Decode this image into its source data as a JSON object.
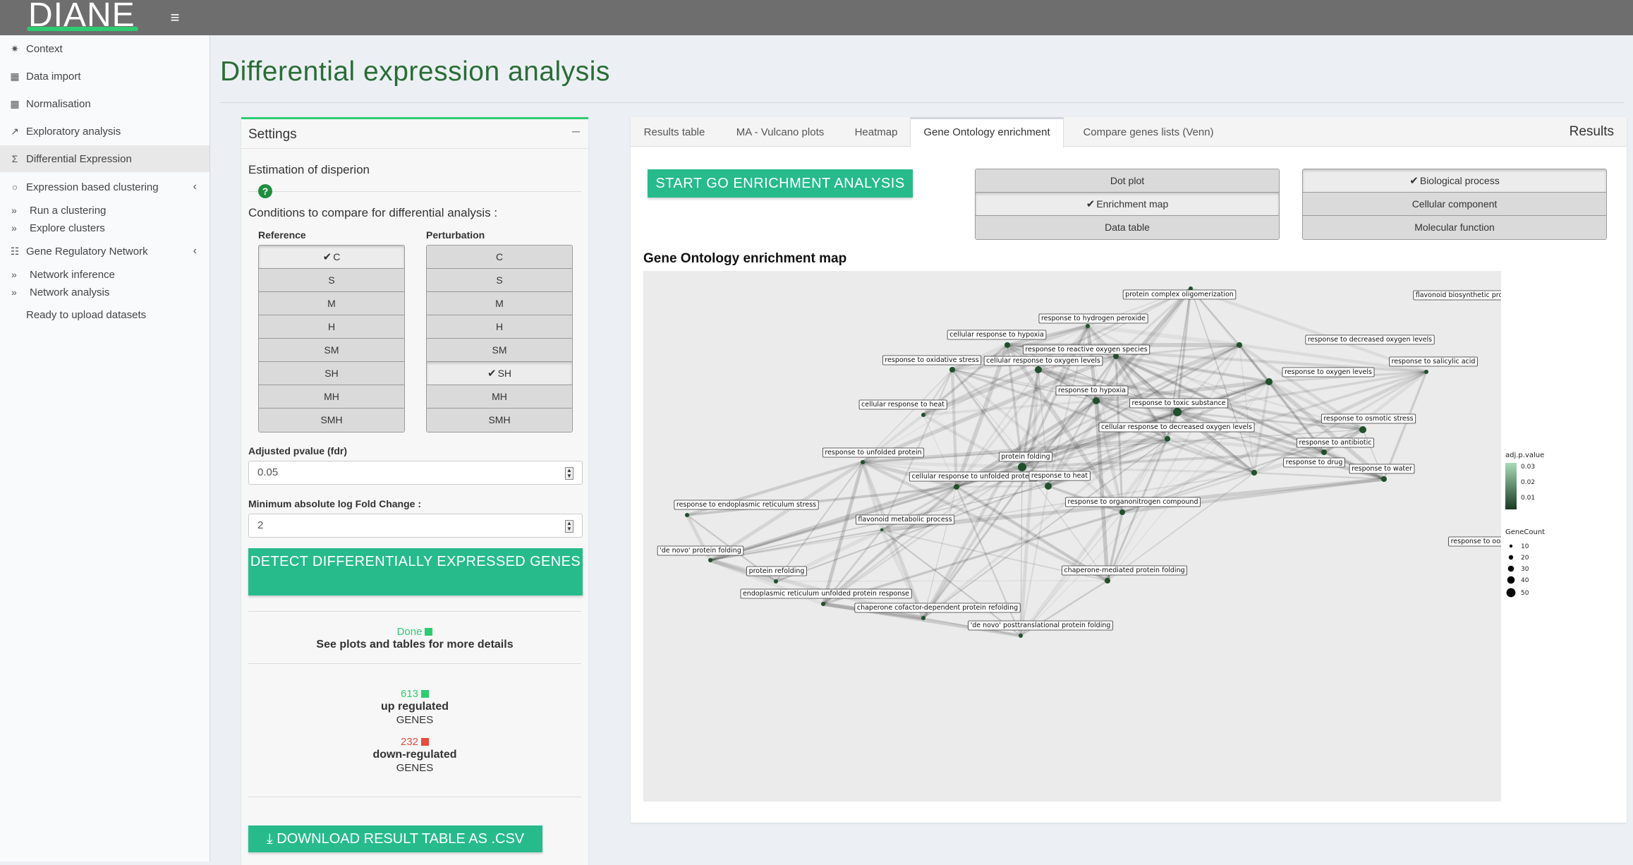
{
  "app": {
    "logo": "DIANE"
  },
  "sidebar": {
    "items": [
      {
        "label": "Context",
        "icon": "seedling-icon"
      },
      {
        "label": "Data import",
        "icon": "table-icon"
      },
      {
        "label": "Normalisation",
        "icon": "table-icon"
      },
      {
        "label": "Exploratory analysis",
        "icon": "line-chart-icon"
      },
      {
        "label": "Differential Expression",
        "icon": "sigma-icon",
        "active": true
      },
      {
        "label": "Expression based clustering",
        "icon": "circle-icon"
      },
      {
        "label": "Run a clustering"
      },
      {
        "label": "Explore clusters"
      },
      {
        "label": "Gene Regulatory Network",
        "icon": "sitemap-icon"
      },
      {
        "label": "Network inference"
      },
      {
        "label": "Network analysis"
      },
      {
        "label": "Ready to upload datasets",
        "icon": "cloud-upload-icon"
      }
    ]
  },
  "page": {
    "title": "Differential expression analysis"
  },
  "settings": {
    "title": "Settings",
    "estimation_label": "Estimation of disperion",
    "conditions_label": "Conditions to compare for differential analysis :",
    "reference_label": "Reference",
    "perturbation_label": "Perturbation",
    "reference_options": [
      "C",
      "S",
      "M",
      "H",
      "SM",
      "SH",
      "MH",
      "SMH"
    ],
    "reference_selected": "C",
    "perturbation_options": [
      "C",
      "S",
      "M",
      "H",
      "SM",
      "SH",
      "MH",
      "SMH"
    ],
    "perturbation_selected": "SH",
    "pvalue_label": "Adjusted pvalue (fdr)",
    "pvalue_value": "0.05",
    "logfc_label": "Minimum absolute log Fold Change :",
    "logfc_value": "2",
    "detect_button": "DETECT DIFFERENTIALLY EXPRESSED GENES",
    "status_done": "Done",
    "status_detail": "See plots and tables for more details",
    "up_count": "613",
    "up_label": "up regulated",
    "up_genes": "GENES",
    "down_count": "232",
    "down_label": "down-regulated",
    "down_genes": "GENES",
    "download_button": "DOWNLOAD RESULT TABLE AS .CSV"
  },
  "results": {
    "title": "Results",
    "tabs": [
      "Results table",
      "MA - Vulcano plots",
      "Heatmap",
      "Gene Ontology enrichment",
      "Compare genes lists (Venn)"
    ],
    "active_tab": "Gene Ontology enrichment",
    "go_button": "START GO ENRICHMENT ANALYSIS",
    "plot_type_options": [
      "Dot plot",
      "Enrichment map",
      "Data table"
    ],
    "plot_type_selected": "Enrichment map",
    "ontology_options": [
      "Biological process",
      "Cellular component",
      "Molecular function"
    ],
    "ontology_selected": "Biological process",
    "plot_title": "Gene Ontology enrichment map",
    "legend": {
      "color_title": "adj.p.value",
      "color_ticks": [
        "0.03",
        "0.02",
        "0.01"
      ],
      "size_title": "GeneCount",
      "size_ticks": [
        "10",
        "20",
        "30",
        "40",
        "50"
      ]
    },
    "network_nodes": [
      "protein complex oligomerization",
      "flavonoid biosynthetic process",
      "response to hydrogen peroxide",
      "cellular response to hypoxia",
      "response to decreased oxygen levels",
      "response to reactive oxygen species",
      "response to oxidative stress",
      "cellular response to oxygen levels",
      "response to salicylic acid",
      "response to oxygen levels",
      "response to hypoxia",
      "response to toxic substance",
      "cellular response to heat",
      "response to osmotic stress",
      "cellular response to decreased oxygen levels",
      "response to antibiotic",
      "response to unfolded protein",
      "protein folding",
      "response to drug",
      "response to water",
      "cellular response to unfolded protein",
      "response to heat",
      "response to endoplasmic reticulum stress",
      "response to organonitrogen compound",
      "flavonoid metabolic process",
      "response to oomycetes",
      "'de novo' protein folding",
      "protein refolding",
      "chaperone-mediated protein folding",
      "endoplasmic reticulum unfolded protein response",
      "chaperone cofactor-dependent protein refolding",
      "'de novo' posttranslational protein folding"
    ]
  }
}
